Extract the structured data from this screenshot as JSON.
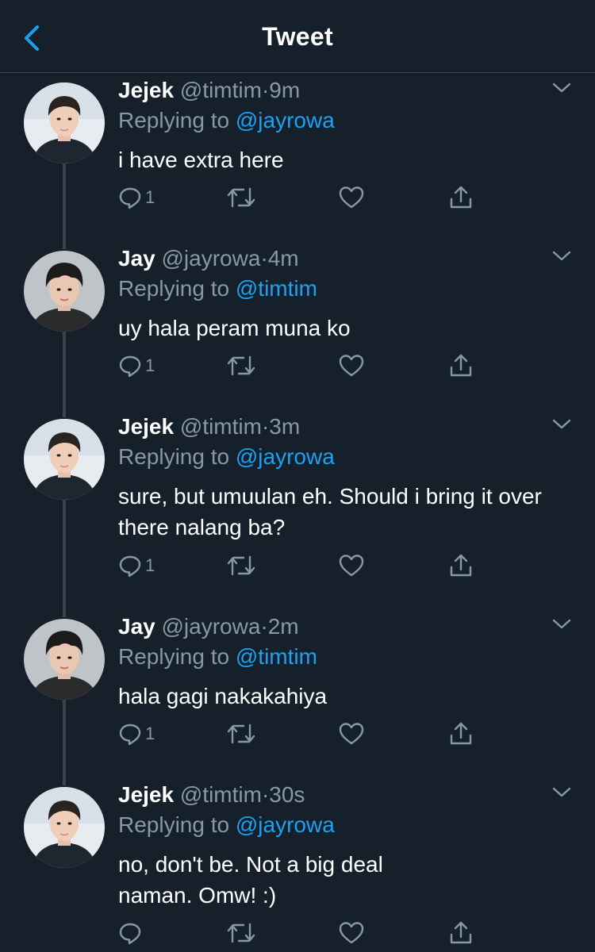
{
  "header": {
    "title": "Tweet"
  },
  "tweets": [
    {
      "name": "Jejek",
      "handle": "@timtim",
      "dot": "·",
      "time": "9m",
      "replying_prefix": "Replying to",
      "replying_to": "@jayrowa",
      "text": "i have extra here",
      "reply_count": "1",
      "avatar": "avatar-jejek"
    },
    {
      "name": "Jay",
      "handle": "@jayrowa",
      "dot": "·",
      "time": "4m",
      "replying_prefix": "Replying to",
      "replying_to": "@timtim",
      "text": "uy hala peram muna ko",
      "reply_count": "1",
      "avatar": "avatar-jay"
    },
    {
      "name": "Jejek",
      "handle": "@timtim",
      "dot": "·",
      "time": "3m",
      "replying_prefix": "Replying to",
      "replying_to": "@jayrowa",
      "text": "sure, but umuulan eh. Should i bring it over there nalang ba?",
      "reply_count": "1",
      "avatar": "avatar-jejek"
    },
    {
      "name": "Jay",
      "handle": "@jayrowa",
      "dot": "·",
      "time": "2m",
      "replying_prefix": "Replying to",
      "replying_to": "@timtim",
      "text": "hala gagi nakakahiya",
      "reply_count": "1",
      "avatar": "avatar-jay"
    },
    {
      "name": "Jejek",
      "handle": "@timtim",
      "dot": "·",
      "time": "30s",
      "replying_prefix": "Replying to",
      "replying_to": "@jayrowa",
      "text": "no, don't be. Not a big deal naman. Omw! :)",
      "reply_count": "",
      "avatar": "avatar-jejek"
    }
  ],
  "colors": {
    "background": "#15202b",
    "accent": "#1da1f2",
    "secondary_text": "#8899a6",
    "divider": "#38444d"
  },
  "icons": [
    "back-chevron-icon",
    "caret-down-icon",
    "reply-icon",
    "retweet-icon",
    "like-heart-icon",
    "share-icon"
  ]
}
